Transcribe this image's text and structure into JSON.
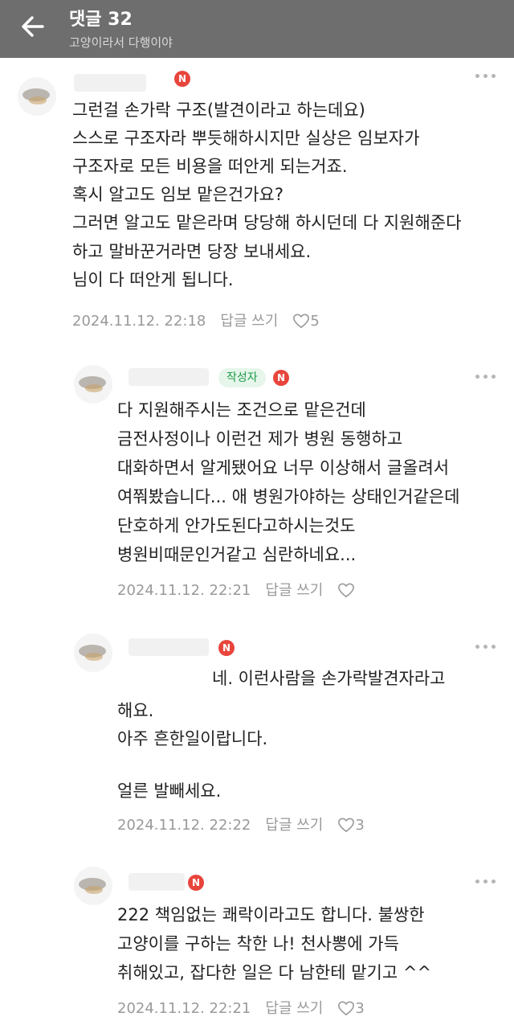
{
  "header": {
    "title": "댓글 32",
    "subtitle": "고양이라서 다행이야"
  },
  "icons": {
    "back": "arrow-left-icon",
    "more": "more-dots-icon",
    "like": "heart-icon",
    "new": "new-badge-icon"
  },
  "colors": {
    "header_bg": "#6e6e6e",
    "badge_new": "#e8453c",
    "author_badge_bg": "#e6f6ea",
    "author_badge_text": "#1d9a4a"
  },
  "comments": [
    {
      "new_badge": "N",
      "lines": [
        "그런걸 손가락 구조(발견이라고 하는데요)",
        "스스로 구조자라 뿌듯해하시지만 실상은 임보자가",
        "구조자로 모든 비용을 떠안게 되는거죠.",
        "혹시 알고도 임보 맡은건가요?",
        "그러면 알고도 맡은라며 당당해 하시던데 다 지원해준다",
        "하고 말바꾼거라면 당장 보내세요.",
        "님이 다 떠안게 됩니다."
      ],
      "date": "2024.11.12. 22:18",
      "reply_label": "답글 쓰기",
      "likes": "5"
    },
    {
      "author_badge": "작성자",
      "new_badge": "N",
      "lines": [
        "다 지원해주시는 조건으로 맡은건데",
        "금전사정이나 이런건 제가 병원 동행하고",
        "대화하면서 알게됐어요 너무 이상해서 글올려서",
        "여쭤봤습니다... 애 병원가야하는 상태인거같은데",
        "단호하게 안가도된다고하시는것도",
        "병원비때문인거같고 심란하네요..."
      ],
      "date": "2024.11.12. 22:21",
      "reply_label": "답글 쓰기",
      "likes": ""
    },
    {
      "new_badge": "N",
      "lines": [
        "네. 이런사람을 손가락발견자라고",
        "해요.",
        "아주 흔한일이랍니다.",
        "",
        "얼른 발빼세요."
      ],
      "date": "2024.11.12. 22:22",
      "reply_label": "답글 쓰기",
      "likes": "3"
    },
    {
      "new_badge": "N",
      "lines": [
        "222 책임없는 쾌락이라고도 합니다. 불쌍한",
        "고양이를 구하는 착한 나! 천사뽕에 가득",
        "취해있고, 잡다한 일은 다 남한테 맡기고 ^^"
      ],
      "date": "2024.11.12. 22:21",
      "reply_label": "답글 쓰기",
      "likes": "3"
    }
  ]
}
